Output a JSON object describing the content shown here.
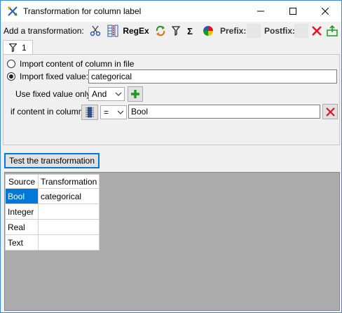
{
  "window": {
    "title": "Transformation for column label"
  },
  "toolbar": {
    "add_label": "Add a transformation:",
    "regex_label": "RegEx",
    "sum_symbol": "Σ",
    "prefix_label": "Prefix:",
    "postfix_label": "Postfix:",
    "icons": [
      "scissors-icon",
      "split-icon",
      "regex-button",
      "replace-icon",
      "filter-icon",
      "sum-icon",
      "color-icon",
      "prefix-box",
      "postfix-box",
      "delete-icon",
      "export-icon"
    ]
  },
  "tab": {
    "label": "1",
    "icon": "filter-icon"
  },
  "options": {
    "import_content_label": "Import content of column in file",
    "import_fixed_label": "Import fixed value:",
    "fixed_value": "categorical",
    "use_fixed_only_label": "Use fixed value only",
    "logic_operator": "And",
    "condition_label": "if content in column",
    "condition_operator": "=",
    "condition_value": "Bool"
  },
  "test_button_label": "Test the transformation",
  "result_table": {
    "columns": [
      "Source",
      "Transformation"
    ],
    "rows": [
      [
        "Bool",
        "categorical"
      ],
      [
        "Integer",
        ""
      ],
      [
        "Real",
        ""
      ],
      [
        "Text",
        ""
      ]
    ],
    "selected_row": 0
  },
  "colors": {
    "accent": "#0078d7",
    "delete_red": "#e81123",
    "add_green": "#1e9a1e",
    "grid_background": "#ababab"
  }
}
